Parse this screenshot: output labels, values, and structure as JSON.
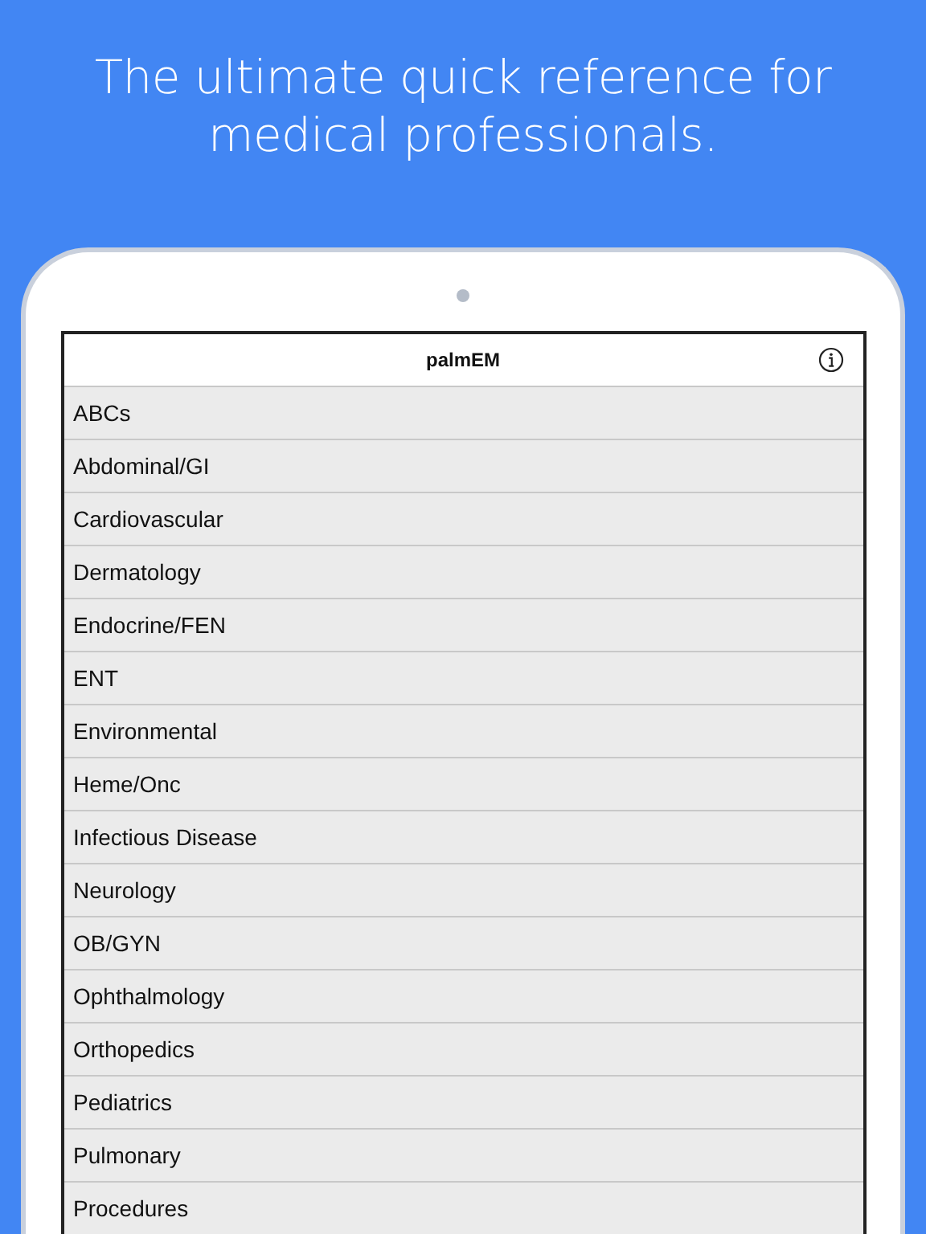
{
  "headline": "The ultimate quick reference for medical professionals.",
  "nav": {
    "title": "palmEM"
  },
  "items": [
    {
      "label": "ABCs"
    },
    {
      "label": "Abdominal/GI"
    },
    {
      "label": "Cardiovascular"
    },
    {
      "label": "Dermatology"
    },
    {
      "label": "Endocrine/FEN"
    },
    {
      "label": "ENT"
    },
    {
      "label": "Environmental"
    },
    {
      "label": "Heme/Onc"
    },
    {
      "label": "Infectious Disease"
    },
    {
      "label": "Neurology"
    },
    {
      "label": "OB/GYN"
    },
    {
      "label": "Ophthalmology"
    },
    {
      "label": "Orthopedics"
    },
    {
      "label": "Pediatrics"
    },
    {
      "label": "Pulmonary"
    },
    {
      "label": "Procedures"
    }
  ]
}
